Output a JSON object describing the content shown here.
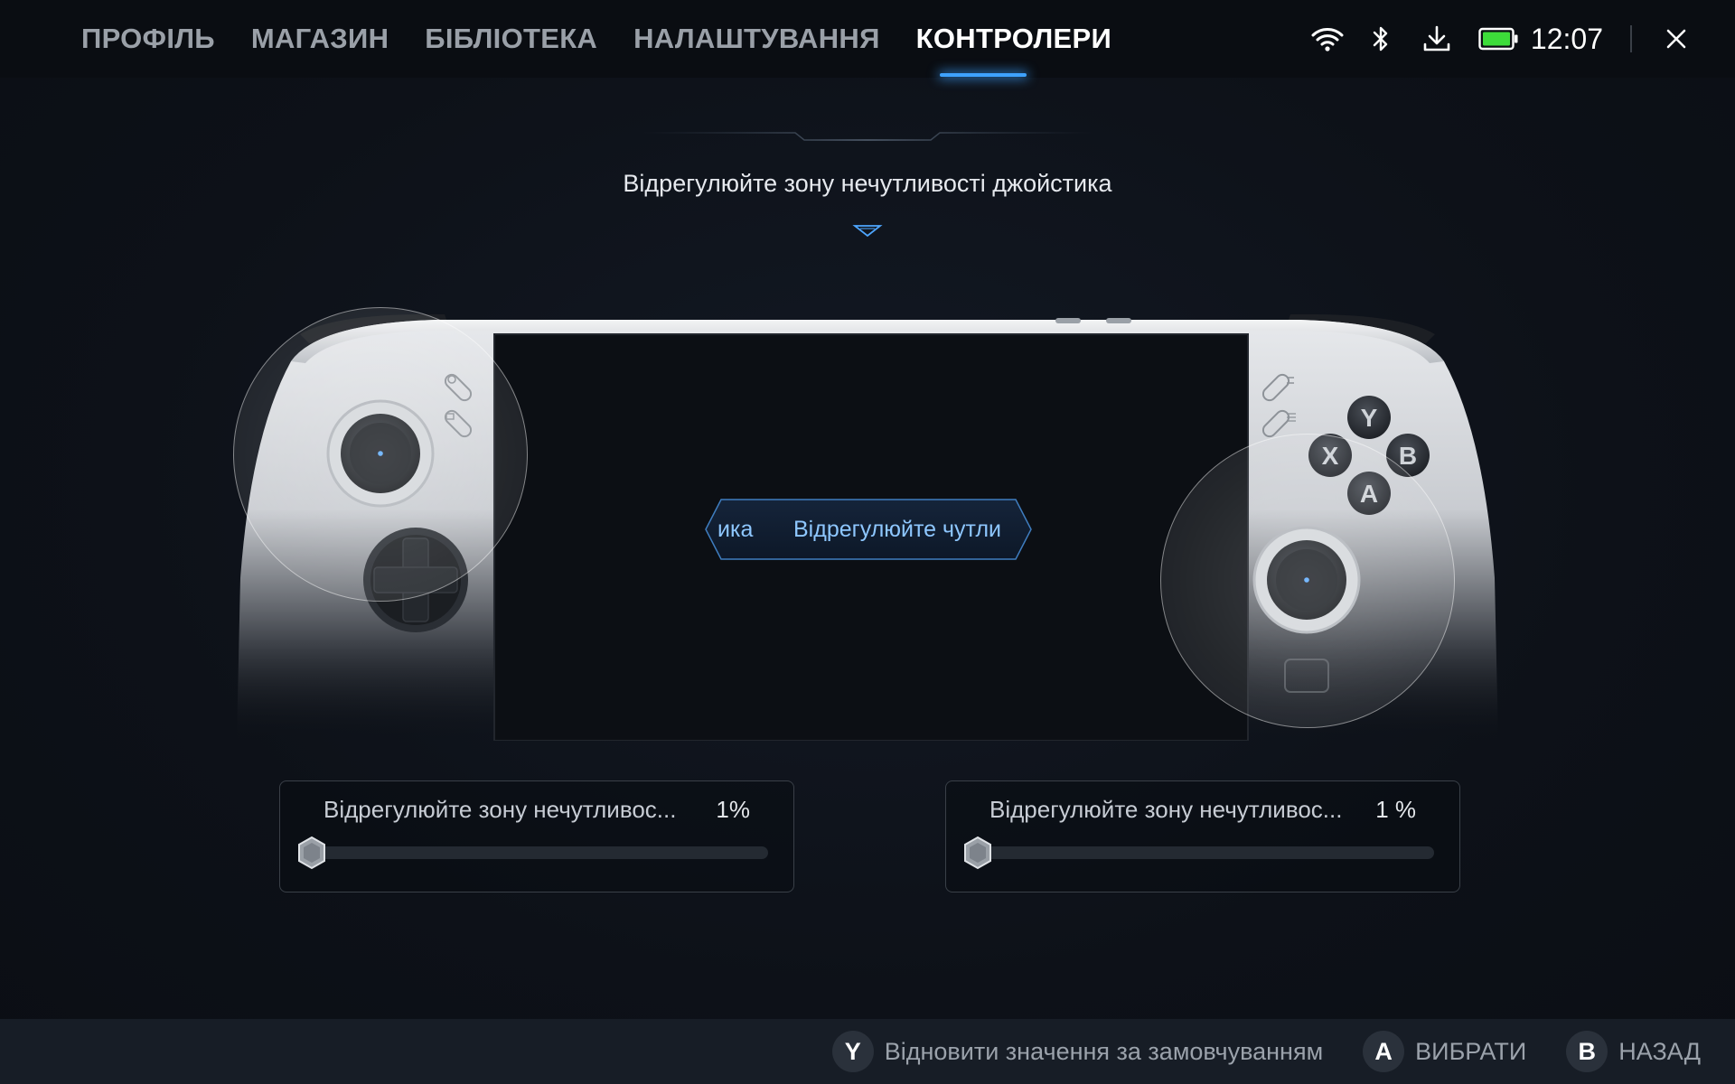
{
  "tabs": [
    {
      "label": "ПРОФІЛЬ"
    },
    {
      "label": "МАГАЗИН"
    },
    {
      "label": "БІБЛІОТЕКА"
    },
    {
      "label": "НАЛАШТУВАННЯ"
    },
    {
      "label": "КОНТРОЛЕРИ"
    }
  ],
  "status": {
    "clock": "12:07",
    "icons": [
      "wifi-icon",
      "bluetooth-icon",
      "download-icon",
      "battery-icon",
      "close-icon"
    ],
    "battery_color": "#3ddc3a"
  },
  "heading": "Відрегулюйте зону нечутливості джойстика",
  "device": {
    "buttons": [
      "Y",
      "X",
      "B",
      "A"
    ]
  },
  "banner": {
    "prev_text": "ика",
    "main_text": "Відрегулюйте чутли"
  },
  "sliders": [
    {
      "label": "Відрегулюйте зону нечутливос...",
      "value_text": "1%",
      "value": 1
    },
    {
      "label": "Відрегулюйте зону нечутливос...",
      "value_text": "1 %",
      "value": 1
    }
  ],
  "hints": [
    {
      "button": "Y",
      "label": "Відновити значення за замовчуванням"
    },
    {
      "button": "A",
      "label": "ВИБРАТИ"
    },
    {
      "button": "B",
      "label": "НАЗАД"
    }
  ],
  "colors": {
    "accent": "#3ea2ff",
    "background": "#0d1118"
  }
}
